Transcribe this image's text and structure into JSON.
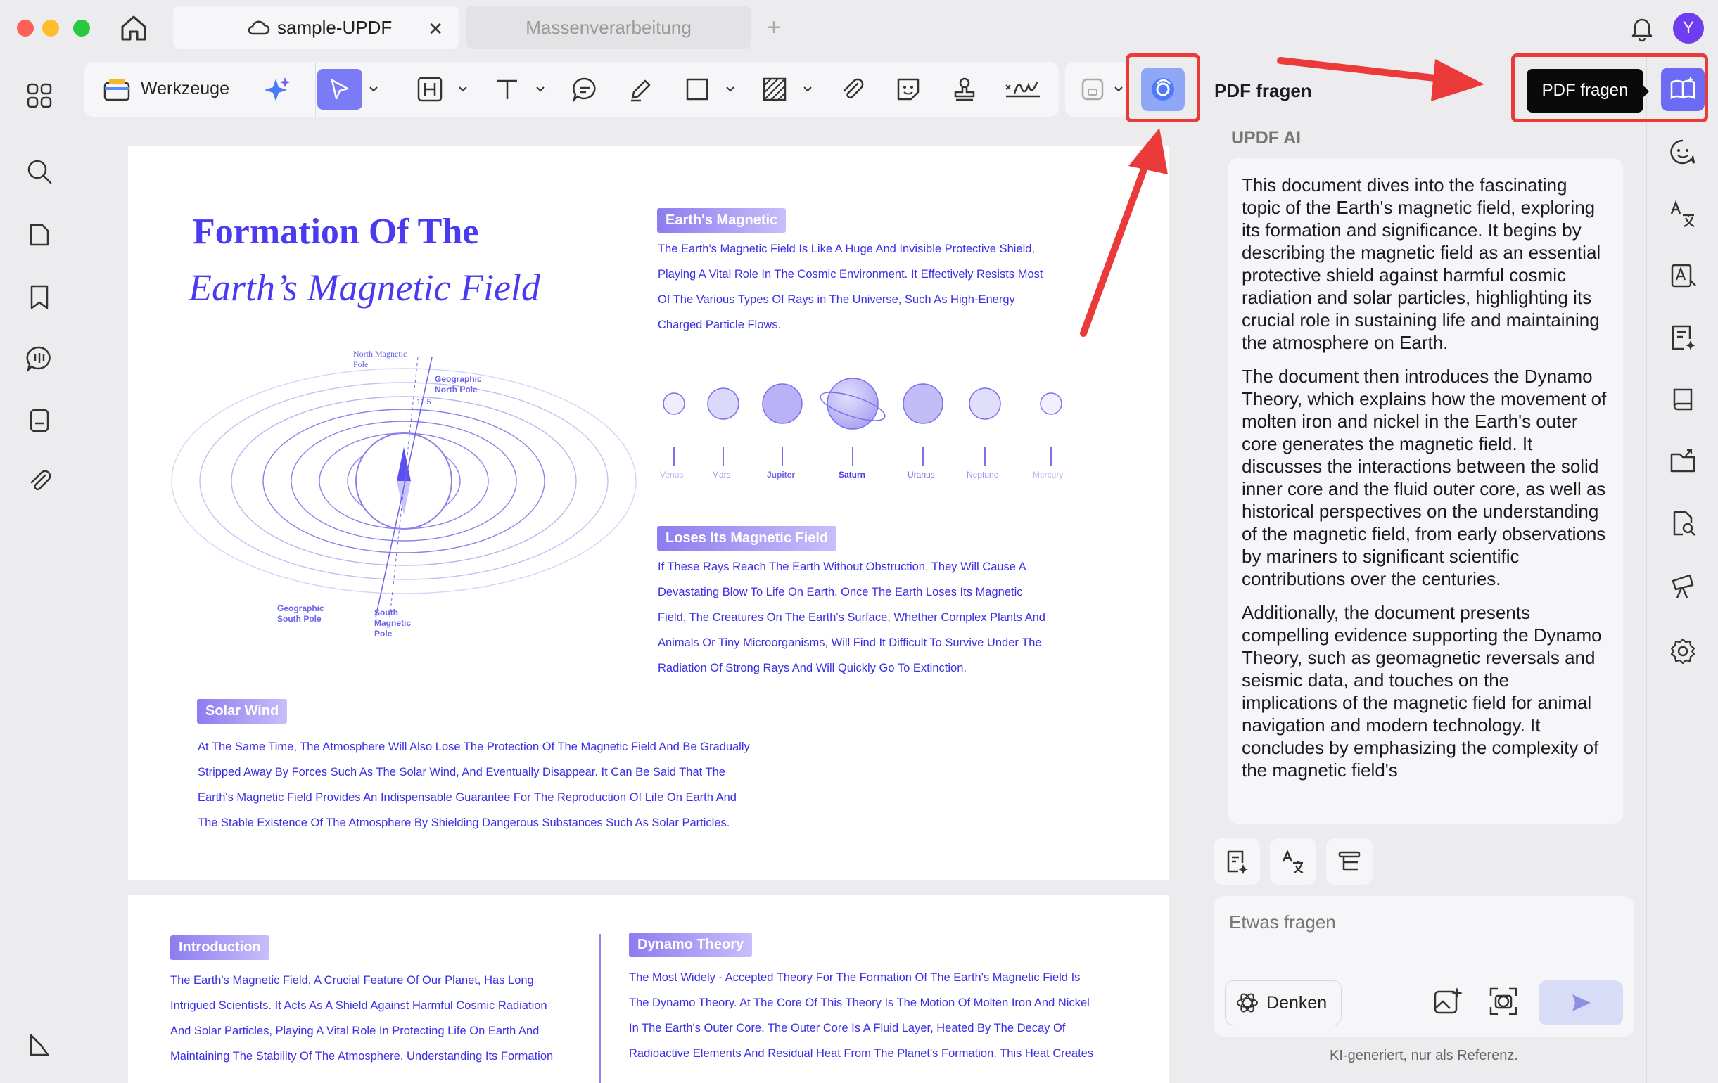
{
  "window": {
    "tabs": [
      {
        "label": "sample-UPDF",
        "active": true
      },
      {
        "label": "Massenverarbeitung",
        "active": false
      }
    ],
    "avatar_letter": "Y"
  },
  "toolbar": {
    "tools_label": "Werkzeuge"
  },
  "document": {
    "page1": {
      "title_line1": "Formation Of The",
      "title_line2": "Earth’s Magnetic Field",
      "diagram_labels": {
        "north_magnetic_pole": "North Magnetic Pole",
        "geographic_north_pole": "Geographic North Pole",
        "angle": "11.5",
        "geographic_south_pole": "Geographic South Pole",
        "south_magnetic_pole": "South Magnetic Pole"
      },
      "section1_badge": "Earth's Magnetic",
      "section1_lines": [
        "The Earth's Magnetic Field Is Like A Huge And Invisible Protective Shield,",
        "Playing A Vital Role In The Cosmic Environment. It Effectively Resists Most",
        "Of The Various Types Of Rays in The Universe, Such As High-Energy",
        "Charged Particle Flows."
      ],
      "planets": [
        "Venus",
        "Mars",
        "Jupiter",
        "Saturn",
        "Uranus",
        "Neptune",
        "Mercury"
      ],
      "section2_badge": "Loses Its Magnetic Field",
      "section2_lines": [
        "If These Rays Reach The Earth Without Obstruction, They Will Cause A",
        "Devastating Blow To Life On Earth. Once The Earth Loses Its Magnetic",
        "Field, The Creatures On The Earth's Surface, Whether Complex Plants And",
        "Animals Or Tiny Microorganisms, Will Find It Difficult To Survive Under The",
        "Radiation Of Strong Rays And Will Quickly Go To Extinction."
      ],
      "section3_badge": "Solar Wind",
      "section3_lines": [
        "At The Same Time, The Atmosphere Will Also Lose The Protection Of The Magnetic Field And Be Gradually",
        "Stripped Away By Forces Such As The Solar Wind, And Eventually Disappear. It Can Be Said That The",
        "Earth's Magnetic Field Provides An Indispensable Guarantee For The Reproduction Of Life On Earth And",
        "The Stable Existence Of The Atmosphere By Shielding Dangerous Substances Such As Solar Particles."
      ]
    },
    "page2": {
      "intro_badge": "Introduction",
      "intro_lines": [
        "The Earth's Magnetic Field, A Crucial Feature Of Our Planet, Has Long",
        "Intrigued Scientists. It Acts As A Shield Against Harmful Cosmic Radiation",
        "And Solar Particles, Playing A Vital Role In Protecting Life On Earth And",
        "Maintaining The Stability Of The Atmosphere. Understanding Its Formation"
      ],
      "dynamo_badge": "Dynamo Theory",
      "dynamo_lines": [
        "The Most Widely - Accepted Theory For The Formation Of The Earth's Magnetic Field Is",
        "The Dynamo Theory. At The Core Of This Theory Is The Motion Of Molten Iron And Nickel",
        "In The Earth's Outer Core. The Outer Core Is A Fluid Layer, Heated By The Decay Of",
        "Radioactive Elements And Residual Heat From The Planet's Formation. This Heat Creates"
      ]
    }
  },
  "ai_panel": {
    "header_title": "PDF fragen",
    "tooltip": "PDF fragen",
    "section_label": "UPDF AI",
    "paragraphs": [
      "This document dives into the fascinating topic of the Earth's magnetic field, exploring its formation and significance. It begins by describing the magnetic field as an essential protective shield against harmful cosmic radiation and solar particles, highlighting its crucial role in sustaining life and maintaining the atmosphere on Earth.",
      "The document then introduces the Dynamo Theory, which explains how the movement of molten iron and nickel in the Earth's outer core generates the magnetic field. It discusses the interactions between the solid inner core and the fluid outer core, as well as historical perspectives on the understanding of the magnetic field, from early observations by mariners to significant scientific contributions over the centuries.",
      "Additionally, the document presents compelling evidence supporting the Dynamo Theory, such as geomagnetic reversals and seismic data, and touches on the implications of the magnetic field for animal navigation and modern technology. It concludes by emphasizing the complexity of the magnetic field's"
    ],
    "input_placeholder": "Etwas fragen",
    "think_label": "Denken",
    "disclaimer": "KI-generiert, nur als Referenz."
  },
  "colors": {
    "accent": "#6b6bf5",
    "document_text": "#3b2ee6",
    "annotation_red": "#ea3a3a"
  }
}
